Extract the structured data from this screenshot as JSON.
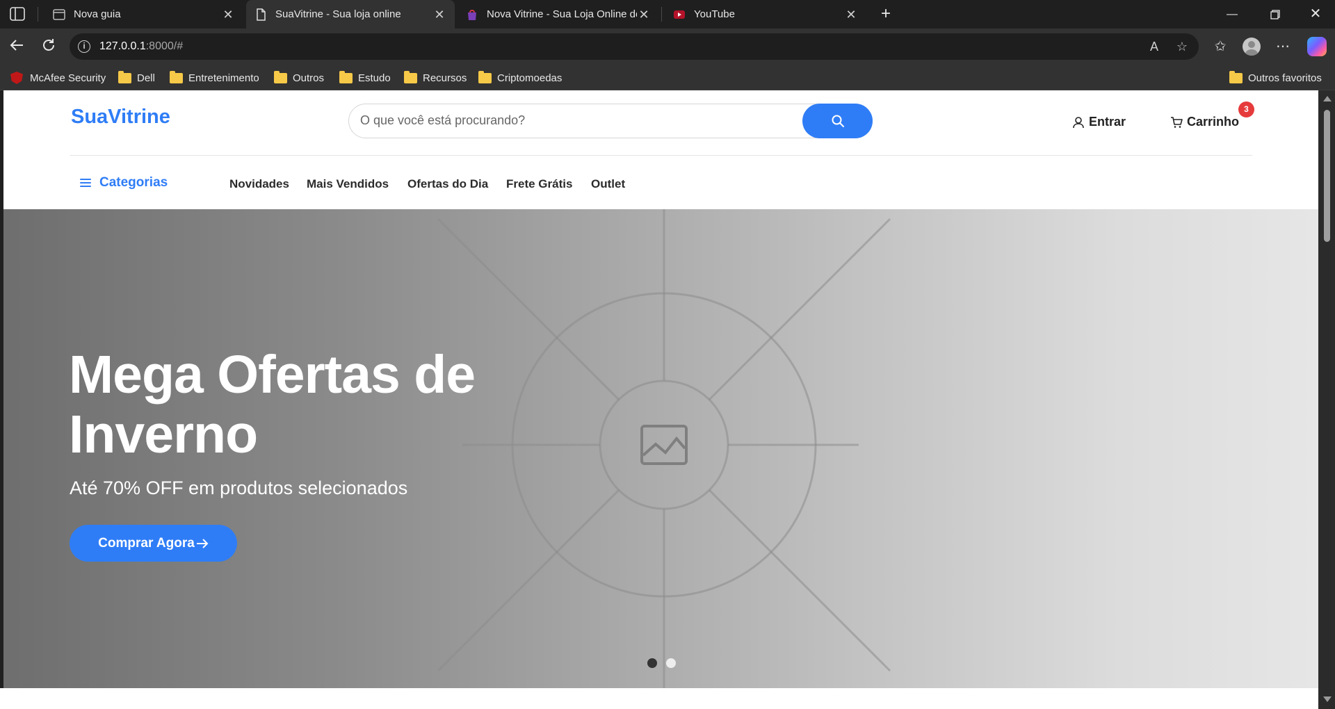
{
  "browser": {
    "tabs": [
      {
        "title": "Nova guia",
        "active": false
      },
      {
        "title": "SuaVitrine - Sua loja online",
        "active": true
      },
      {
        "title": "Nova Vitrine - Sua Loja Online de",
        "active": false
      },
      {
        "title": "YouTube",
        "active": false
      }
    ],
    "url_host": "127.0.0.1",
    "url_rest": ":8000/#",
    "bookmarks": [
      "McAfee Security",
      "Dell",
      "Entretenimento",
      "Outros",
      "Estudo",
      "Recursos",
      "Criptomoedas"
    ],
    "other_favorites": "Outros favoritos"
  },
  "site": {
    "logo": "SuaVitrine",
    "search_placeholder": "O que você está procurando?",
    "login_label": "Entrar",
    "cart_label": "Carrinho",
    "cart_count": "3",
    "categories_label": "Categorias",
    "nav_links": [
      "Novidades",
      "Mais Vendidos",
      "Ofertas do Dia",
      "Frete Grátis",
      "Outlet"
    ]
  },
  "hero": {
    "title_line1": "Mega Ofertas de",
    "title_line2": "Inverno",
    "subtitle": "Até 70% OFF em produtos selecionados",
    "cta": "Comprar Agora",
    "slides_total": 2,
    "active_slide": 1
  },
  "colors": {
    "brand": "#2f7df6",
    "badge": "#e63b3b"
  }
}
